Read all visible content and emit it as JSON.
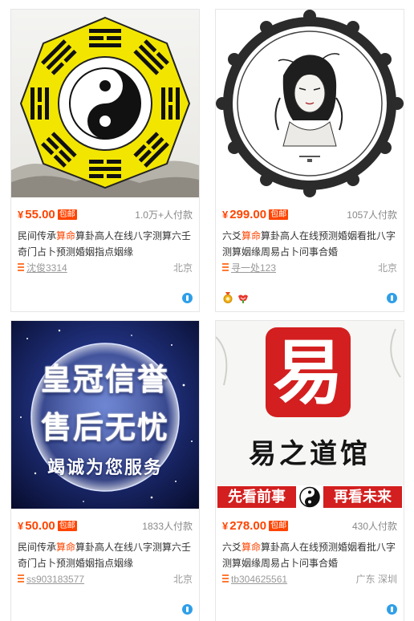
{
  "products": [
    {
      "price": "55.00",
      "currency": "¥",
      "shipping_badge": "包邮",
      "sales": "1.0万+人付款",
      "title_pre": "民间传承",
      "title_hl": "算命",
      "title_post": "算卦高人在线八字测算六壬奇门占卜预测婚姻指点姻缘",
      "shop": "沈俊3314",
      "location": "北京"
    },
    {
      "price": "299.00",
      "currency": "¥",
      "shipping_badge": "包邮",
      "sales": "1057人付款",
      "title_pre": "六爻",
      "title_hl": "算命",
      "title_post": "算卦高人在线预测婚姻看批八字测算姻缘周易占卜问事合婚",
      "shop": "寻一处123",
      "location": "北京"
    },
    {
      "price": "50.00",
      "currency": "¥",
      "shipping_badge": "包邮",
      "sales": "1833人付款",
      "title_pre": "民间传承",
      "title_hl": "算命",
      "title_post": "算卦高人在线八字测算六壬奇门占卜预测婚姻指点姻缘",
      "shop": "ss903183577",
      "location": "北京",
      "image_text_1": "皇冠信誉",
      "image_text_2": "售后无忧",
      "image_text_3": "竭诚为您服务"
    },
    {
      "price": "278.00",
      "currency": "¥",
      "shipping_badge": "包邮",
      "sales": "430人付款",
      "title_pre": "六爻",
      "title_hl": "算命",
      "title_post": "算卦高人在线预测婚姻看批八字测算姻缘周易占卜问事合婚",
      "shop": "tb304625561",
      "location": "广东 深圳",
      "image_text_big": "易",
      "image_text_1": "易之道馆",
      "image_text_2": "先看前事",
      "image_text_3": "再看未来"
    }
  ],
  "colors": {
    "accent": "#ff4400",
    "wangwang": "#2f9fe8"
  }
}
